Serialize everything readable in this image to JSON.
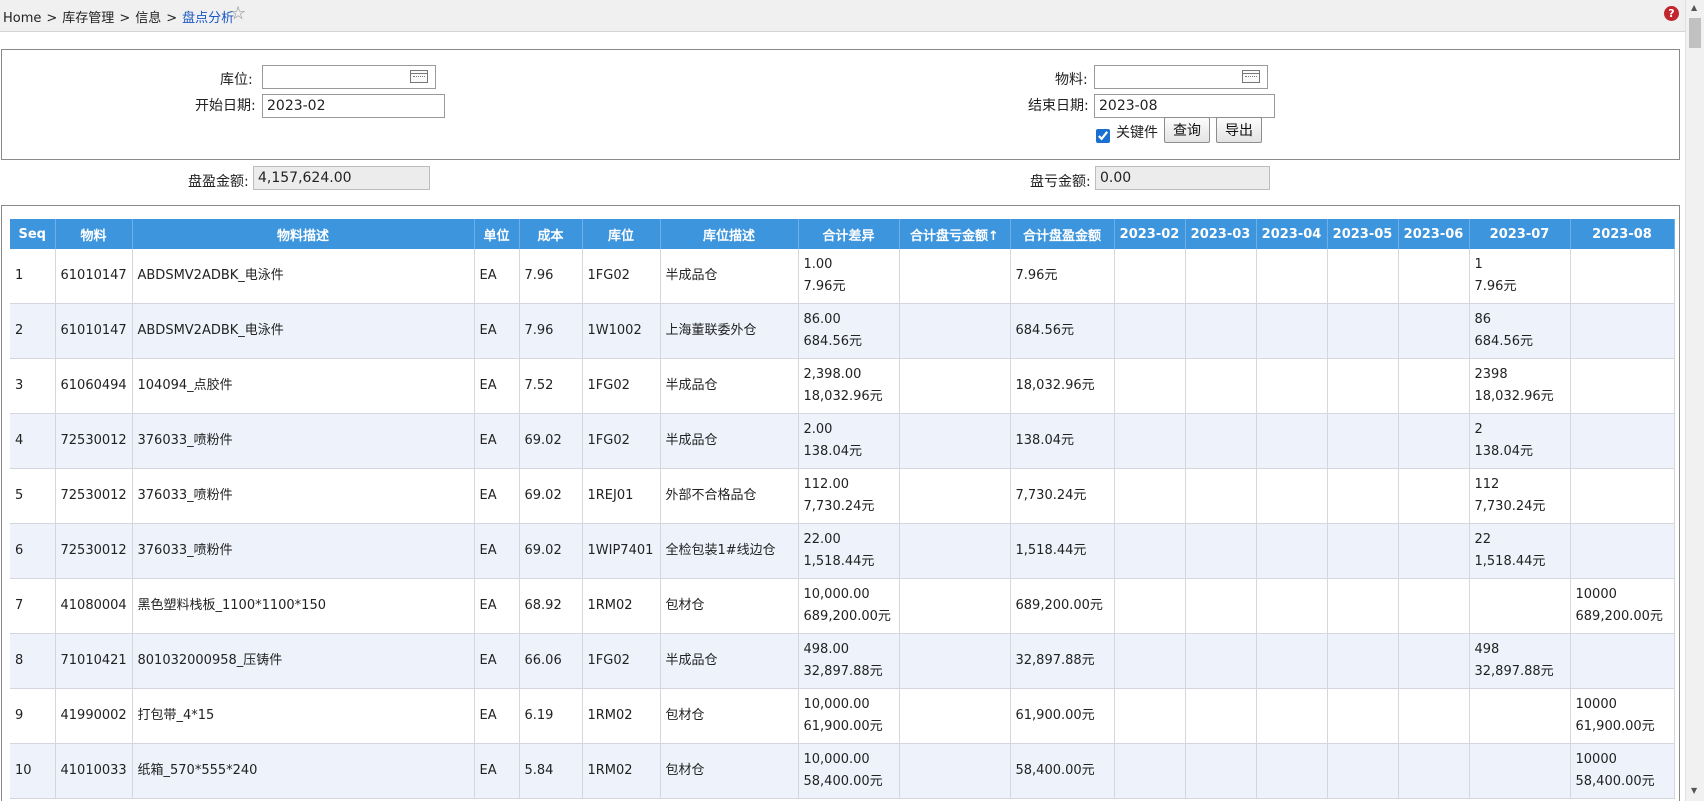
{
  "breadcrumb": {
    "home": "Home",
    "sep": ">",
    "l1": "库存管理",
    "l2": "信息",
    "current": "盘点分析"
  },
  "icons": {
    "favorite": "star-icon",
    "help": "help-icon",
    "calendar": "calendar-icon"
  },
  "help_glyph": "?",
  "filters": {
    "location_label": "库位:",
    "location_value": "",
    "material_label": "物料:",
    "material_value": "",
    "start_label": "开始日期:",
    "start_value": "2023-02",
    "end_label": "结束日期:",
    "end_value": "2023-08",
    "key_part_label": "关键件",
    "key_part_checked": true,
    "query_button": "查询",
    "export_button": "导出"
  },
  "summary": {
    "gain_label": "盘盈金额:",
    "gain_value": "4,157,624.00",
    "loss_label": "盘亏金额:",
    "loss_value": "0.00"
  },
  "colors": {
    "header_bg": "#3d95dd",
    "alt_row": "#eef3fb",
    "link": "#1a56c4"
  },
  "table": {
    "columns": [
      "Seq",
      "物料",
      "物料描述",
      "单位",
      "成本",
      "库位",
      "库位描述",
      "合计差异",
      "合计盘亏金额↑",
      "合计盘盈金额",
      "2023-02",
      "2023-03",
      "2023-04",
      "2023-05",
      "2023-06",
      "2023-07",
      "2023-08"
    ],
    "rows": [
      {
        "seq": "1",
        "material": "61010147",
        "desc": "ABDSMV2ADBK_电泳件",
        "unit": "EA",
        "cost": "7.96",
        "loc": "1FG02",
        "loc_desc": "半成品仓",
        "diff_qty": "1.00",
        "diff_amt": "7.96元",
        "loss": "",
        "gain": "7.96元",
        "m02": [
          "",
          ""
        ],
        "m03": [
          "",
          ""
        ],
        "m04": [
          "",
          ""
        ],
        "m05": [
          "",
          ""
        ],
        "m06": [
          "",
          ""
        ],
        "m07": [
          "1",
          "7.96元"
        ],
        "m08": [
          "",
          ""
        ]
      },
      {
        "seq": "2",
        "material": "61010147",
        "desc": "ABDSMV2ADBK_电泳件",
        "unit": "EA",
        "cost": "7.96",
        "loc": "1W1002",
        "loc_desc": "上海董联委外仓",
        "diff_qty": "86.00",
        "diff_amt": "684.56元",
        "loss": "",
        "gain": "684.56元",
        "m02": [
          "",
          ""
        ],
        "m03": [
          "",
          ""
        ],
        "m04": [
          "",
          ""
        ],
        "m05": [
          "",
          ""
        ],
        "m06": [
          "",
          ""
        ],
        "m07": [
          "86",
          "684.56元"
        ],
        "m08": [
          "",
          ""
        ]
      },
      {
        "seq": "3",
        "material": "61060494",
        "desc": "104094_点胶件",
        "unit": "EA",
        "cost": "7.52",
        "loc": "1FG02",
        "loc_desc": "半成品仓",
        "diff_qty": "2,398.00",
        "diff_amt": "18,032.96元",
        "loss": "",
        "gain": "18,032.96元",
        "m02": [
          "",
          ""
        ],
        "m03": [
          "",
          ""
        ],
        "m04": [
          "",
          ""
        ],
        "m05": [
          "",
          ""
        ],
        "m06": [
          "",
          ""
        ],
        "m07": [
          "2398",
          "18,032.96元"
        ],
        "m08": [
          "",
          ""
        ]
      },
      {
        "seq": "4",
        "material": "72530012",
        "desc": "376033_喷粉件",
        "unit": "EA",
        "cost": "69.02",
        "loc": "1FG02",
        "loc_desc": "半成品仓",
        "diff_qty": "2.00",
        "diff_amt": "138.04元",
        "loss": "",
        "gain": "138.04元",
        "m02": [
          "",
          ""
        ],
        "m03": [
          "",
          ""
        ],
        "m04": [
          "",
          ""
        ],
        "m05": [
          "",
          ""
        ],
        "m06": [
          "",
          ""
        ],
        "m07": [
          "2",
          "138.04元"
        ],
        "m08": [
          "",
          ""
        ]
      },
      {
        "seq": "5",
        "material": "72530012",
        "desc": "376033_喷粉件",
        "unit": "EA",
        "cost": "69.02",
        "loc": "1REJ01",
        "loc_desc": "外部不合格品仓",
        "diff_qty": "112.00",
        "diff_amt": "7,730.24元",
        "loss": "",
        "gain": "7,730.24元",
        "m02": [
          "",
          ""
        ],
        "m03": [
          "",
          ""
        ],
        "m04": [
          "",
          ""
        ],
        "m05": [
          "",
          ""
        ],
        "m06": [
          "",
          ""
        ],
        "m07": [
          "112",
          "7,730.24元"
        ],
        "m08": [
          "",
          ""
        ]
      },
      {
        "seq": "6",
        "material": "72530012",
        "desc": "376033_喷粉件",
        "unit": "EA",
        "cost": "69.02",
        "loc": "1WIP7401",
        "loc_desc": "全检包装1#线边仓",
        "diff_qty": "22.00",
        "diff_amt": "1,518.44元",
        "loss": "",
        "gain": "1,518.44元",
        "m02": [
          "",
          ""
        ],
        "m03": [
          "",
          ""
        ],
        "m04": [
          "",
          ""
        ],
        "m05": [
          "",
          ""
        ],
        "m06": [
          "",
          ""
        ],
        "m07": [
          "22",
          "1,518.44元"
        ],
        "m08": [
          "",
          ""
        ]
      },
      {
        "seq": "7",
        "material": "41080004",
        "desc": "黑色塑料栈板_1100*1100*150",
        "unit": "EA",
        "cost": "68.92",
        "loc": "1RM02",
        "loc_desc": "包材仓",
        "diff_qty": "10,000.00",
        "diff_amt": "689,200.00元",
        "loss": "",
        "gain": "689,200.00元",
        "m02": [
          "",
          ""
        ],
        "m03": [
          "",
          ""
        ],
        "m04": [
          "",
          ""
        ],
        "m05": [
          "",
          ""
        ],
        "m06": [
          "",
          ""
        ],
        "m07": [
          "",
          ""
        ],
        "m08": [
          "10000",
          "689,200.00元"
        ]
      },
      {
        "seq": "8",
        "material": "71010421",
        "desc": "801032000958_压铸件",
        "unit": "EA",
        "cost": "66.06",
        "loc": "1FG02",
        "loc_desc": "半成品仓",
        "diff_qty": "498.00",
        "diff_amt": "32,897.88元",
        "loss": "",
        "gain": "32,897.88元",
        "m02": [
          "",
          ""
        ],
        "m03": [
          "",
          ""
        ],
        "m04": [
          "",
          ""
        ],
        "m05": [
          "",
          ""
        ],
        "m06": [
          "",
          ""
        ],
        "m07": [
          "498",
          "32,897.88元"
        ],
        "m08": [
          "",
          ""
        ]
      },
      {
        "seq": "9",
        "material": "41990002",
        "desc": "打包带_4*15",
        "unit": "EA",
        "cost": "6.19",
        "loc": "1RM02",
        "loc_desc": "包材仓",
        "diff_qty": "10,000.00",
        "diff_amt": "61,900.00元",
        "loss": "",
        "gain": "61,900.00元",
        "m02": [
          "",
          ""
        ],
        "m03": [
          "",
          ""
        ],
        "m04": [
          "",
          ""
        ],
        "m05": [
          "",
          ""
        ],
        "m06": [
          "",
          ""
        ],
        "m07": [
          "",
          ""
        ],
        "m08": [
          "10000",
          "61,900.00元"
        ]
      },
      {
        "seq": "10",
        "material": "41010033",
        "desc": "纸箱_570*555*240",
        "unit": "EA",
        "cost": "5.84",
        "loc": "1RM02",
        "loc_desc": "包材仓",
        "diff_qty": "10,000.00",
        "diff_amt": "58,400.00元",
        "loss": "",
        "gain": "58,400.00元",
        "m02": [
          "",
          ""
        ],
        "m03": [
          "",
          ""
        ],
        "m04": [
          "",
          ""
        ],
        "m05": [
          "",
          ""
        ],
        "m06": [
          "",
          ""
        ],
        "m07": [
          "",
          ""
        ],
        "m08": [
          "10000",
          "58,400.00元"
        ]
      }
    ]
  }
}
